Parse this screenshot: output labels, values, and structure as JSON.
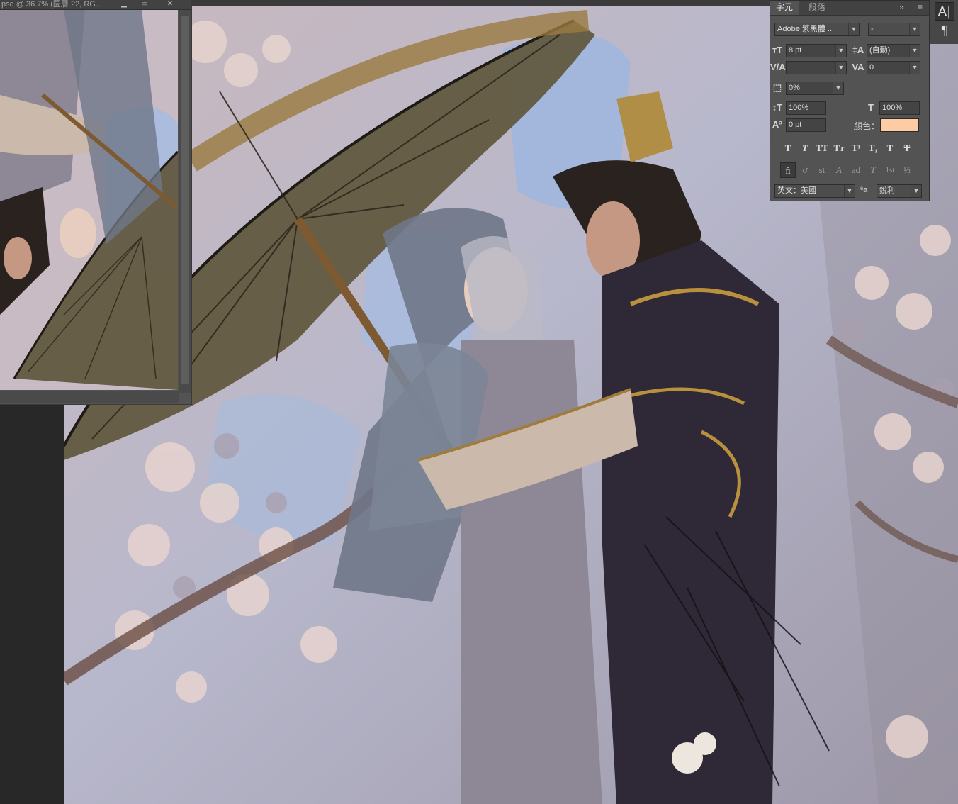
{
  "document_window": {
    "title": "psd @ 36.7% (圖層 22, RG...",
    "min_icon": "minimize-icon",
    "max_icon": "restore-icon",
    "close_icon": "close-icon",
    "min_glyph": "▁",
    "max_glyph": "▭",
    "close_glyph": "✕"
  },
  "character_panel": {
    "tabs": [
      {
        "label": "字元",
        "active": true
      },
      {
        "label": "段落",
        "active": false
      }
    ],
    "expand_glyph": "»",
    "menu_glyph": "≡",
    "font_family": "Adobe 繁黑體 ...",
    "font_style": "-",
    "font_size": "8 pt",
    "leading": "(自動)",
    "kerning": "",
    "tracking": "0",
    "tsume": "0%",
    "vertical_scale": "100%",
    "horizontal_scale": "100%",
    "baseline_shift": "0 pt",
    "color_label": "顏色：",
    "color_value": "#fdcca5",
    "language": "英文：美國",
    "aa_label": "ªa",
    "antialias": "銳利",
    "type_buttons": [
      "T",
      "T",
      "TT",
      "Tт",
      "T¹",
      "T₁",
      "T",
      "T"
    ],
    "opentype_buttons": [
      "ﬁ",
      "ơ",
      "st",
      "A",
      "ad",
      "T",
      "1st",
      "½"
    ]
  },
  "right_dock": {
    "character_glyph": "A|",
    "paragraph_glyph": "¶"
  }
}
